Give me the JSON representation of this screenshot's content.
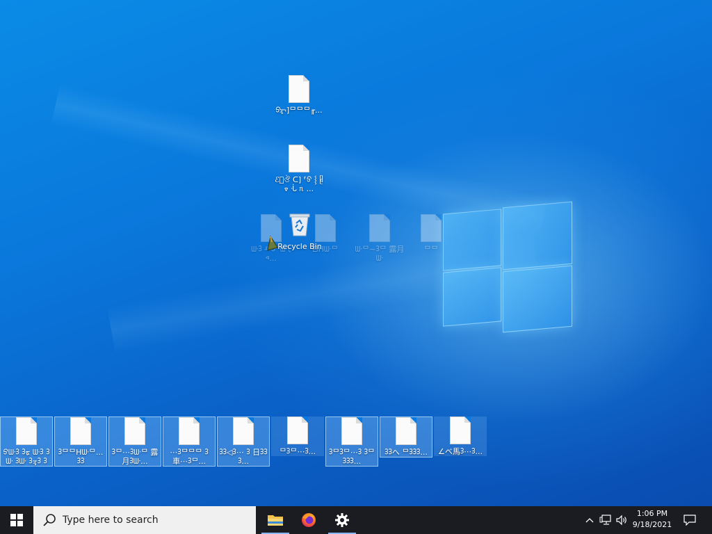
{
  "desktop": {
    "top_icons": [
      {
        "label": "ᢒᢋ]ᄆᄆᄆ╓..."
      },
      {
        "label": "ℰঁঔ ᑕ] ⸢ᢒ ⸾ ᥪ ᢦ ᒞ ᥰ ..."
      }
    ],
    "ghost_icons": [
      {
        "label": "ᣭᢃ ᚈᢃᣚ ᣭᡶᢦ..."
      },
      {
        "label": "ᗷHᣭᄆ"
      },
      {
        "label": "ᣭᄆ~ᢃᄆ 露月ᣭ"
      },
      {
        "label": "ᄆᄆ"
      }
    ],
    "recycle_bin": {
      "label": "Recycle Bin"
    },
    "bottom_icons": [
      {
        "label": "ᢒᣭᢃ ᢃᢘ ᣭᢃ ᢃᣭ ᢃᣭ ᢃᢋᢃ ᢃ",
        "selected": true
      },
      {
        "label": "ᢃᄆᄆHᣭᄆ... ᢃᢃ",
        "selected": true
      },
      {
        "label": "ᢃᄆ⋯ᢃᣭᄆ 露月ᢃᣭ...",
        "selected": true
      },
      {
        "label": "⋯ᢃᄆᄆᄆ ᢃ 車⋯ᢃᄆ...",
        "selected": true
      },
      {
        "label": "ᢃᢃ◁ᢃ⋯ ᢃ 日ᢃᢃᢃ...",
        "selected": true
      },
      {
        "label": "ᄆᢃᄆ⋯ᢃ...",
        "selected": false
      },
      {
        "label": "ᢃᄆᢃᄆ⋯ᢃ ᢃᄆᢃᢃᢃ...",
        "selected": true
      },
      {
        "label": "ᢃᢃへ ᄆᢃᢃᢃ...",
        "selected": true
      },
      {
        "label": "∠ベ馬ᢃ⋯ᢃ...",
        "selected": false
      }
    ]
  },
  "taskbar": {
    "search_placeholder": "Type here to search",
    "apps": [
      {
        "name": "File Explorer",
        "icon": "folder-icon",
        "active": true
      },
      {
        "name": "Firefox",
        "icon": "firefox-icon",
        "active": false
      },
      {
        "name": "Settings",
        "icon": "gear-icon",
        "active": true
      }
    ],
    "clock": {
      "time": "1:06 PM",
      "date": "9/18/2021"
    }
  },
  "colors": {
    "desktop_blue": "#0a78dc",
    "taskbar": "#1a1c22",
    "search_bg": "#f0f0f0"
  }
}
